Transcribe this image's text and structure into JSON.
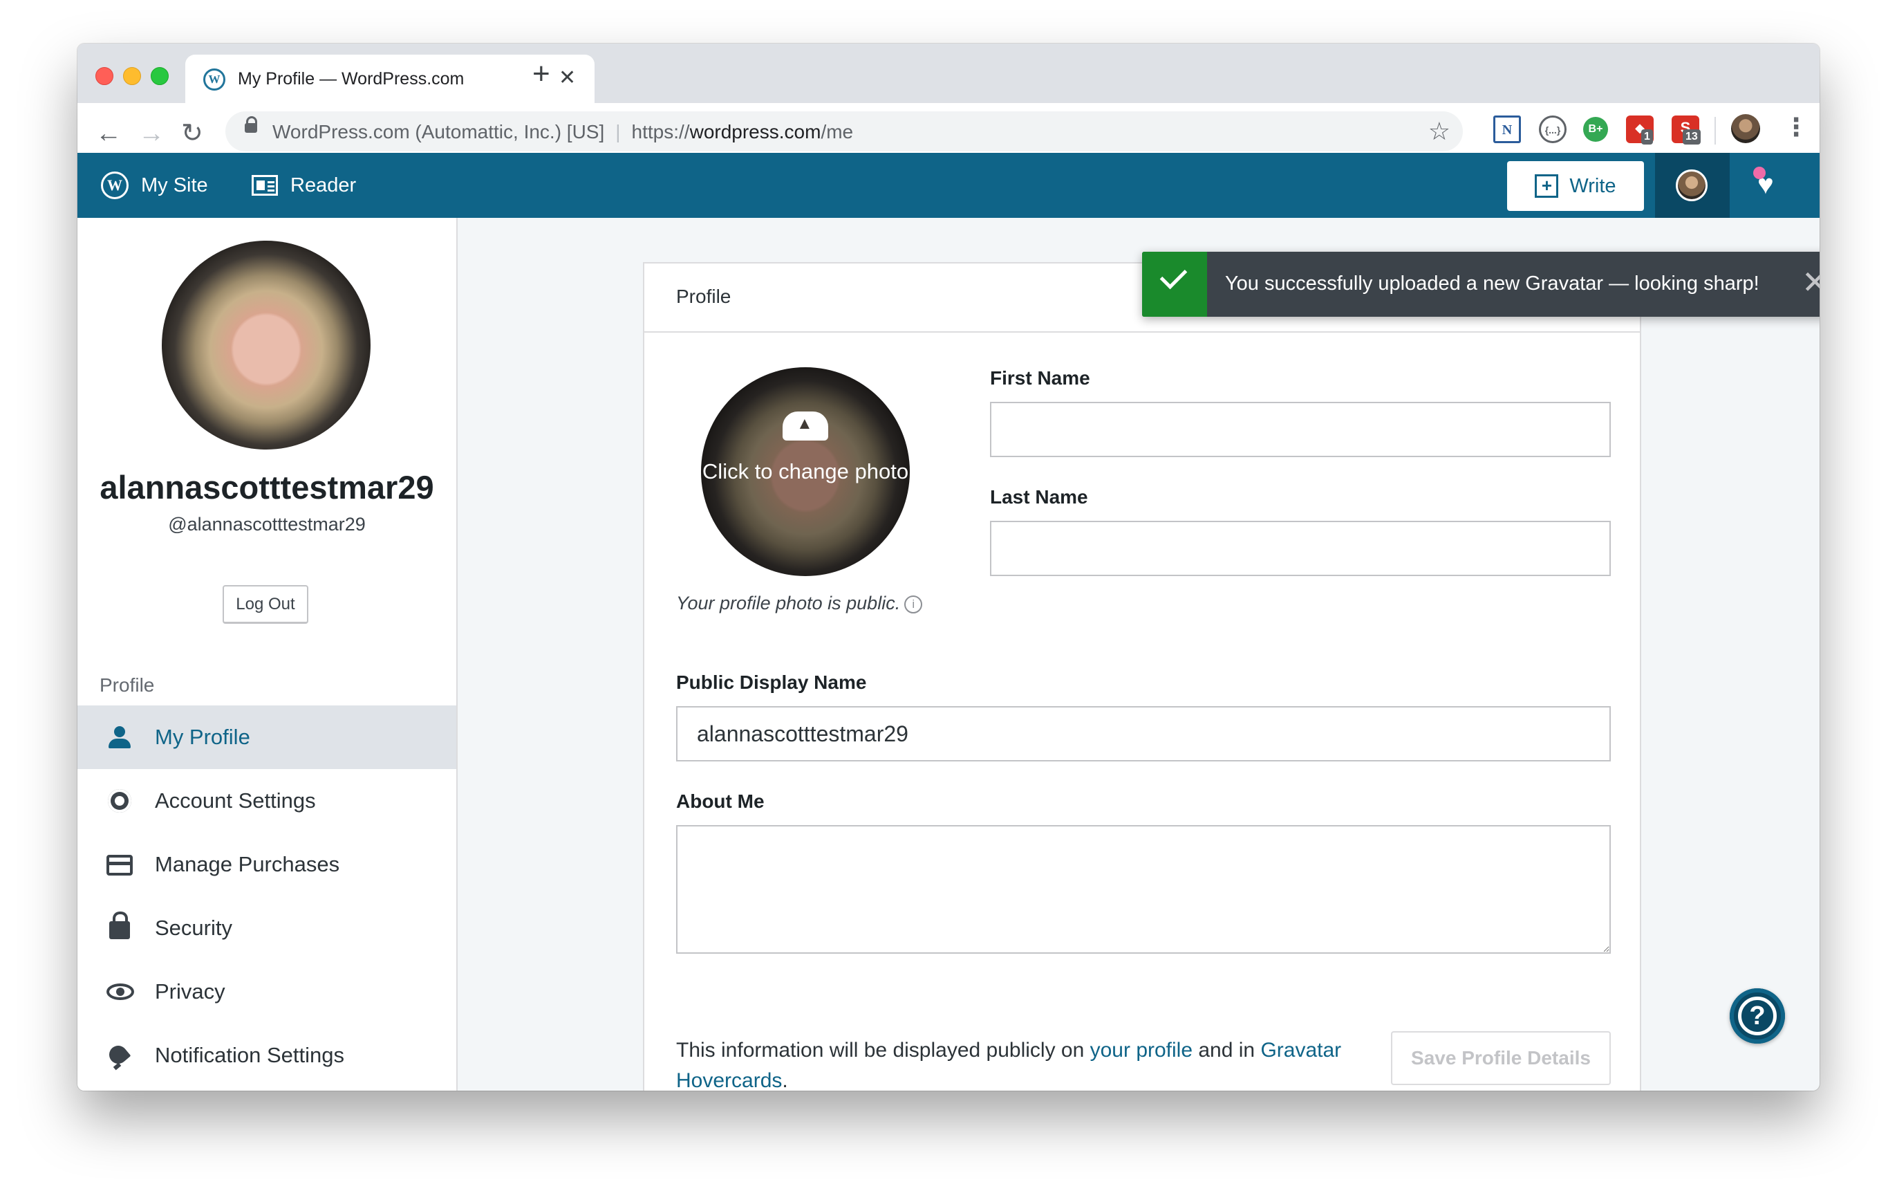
{
  "browser": {
    "tab_title": "My Profile — WordPress.com",
    "tab_close": "✕",
    "new_tab": "+",
    "back": "←",
    "forward": "→",
    "reload": "↻",
    "site_identity": "WordPress.com (Automattic, Inc.) [US]",
    "url_scheme": "https://",
    "url_host": "wordpress.com",
    "url_path": "/me",
    "star": "☆",
    "extensions": {
      "n_label": "N",
      "code_label": "{...}",
      "bplus_label": "B+",
      "shield_label": "◆",
      "shield_badge": "1",
      "s_label": "S",
      "s_badge": "13"
    },
    "menu": "⋮"
  },
  "masterbar": {
    "my_site": "My Site",
    "reader": "Reader",
    "write": "Write",
    "write_icon": "+",
    "notifications_icon": "♥"
  },
  "sidebar": {
    "username": "alannascotttestmar29",
    "handle": "@alannascotttestmar29",
    "logout": "Log Out",
    "section_title": "Profile",
    "items": [
      {
        "label": "My Profile",
        "icon": "person-icon",
        "selected": true
      },
      {
        "label": "Account Settings",
        "icon": "gear-icon"
      },
      {
        "label": "Manage Purchases",
        "icon": "credit-card-icon"
      },
      {
        "label": "Security",
        "icon": "lock-icon"
      },
      {
        "label": "Privacy",
        "icon": "eye-icon"
      },
      {
        "label": "Notification Settings",
        "icon": "bell-icon"
      }
    ]
  },
  "profile": {
    "card_title": "Profile",
    "photo_overlay": "Click to change photo",
    "photo_note": "Your profile photo is public.",
    "info_icon": "i",
    "first_name_label": "First Name",
    "first_name_value": "",
    "last_name_label": "Last Name",
    "last_name_value": "",
    "display_name_label": "Public Display Name",
    "display_name_value": "alannascotttestmar29",
    "about_label": "About Me",
    "about_value": "",
    "footer_prefix": "This information will be displayed publicly on ",
    "footer_link1": "your profile",
    "footer_mid": " and in ",
    "footer_link2": "Gravatar Hovercards",
    "footer_suffix": ".",
    "save_button": "Save Profile Details"
  },
  "notice": {
    "text": "You successfully uploaded a new Gravatar — looking sharp!",
    "close": "✕"
  },
  "help": {
    "label": "?"
  },
  "colors": {
    "masterbar": "#0f6488",
    "masterbar_dark": "#0a4864",
    "link": "#0f6488",
    "notice_bg": "#3c434a",
    "notice_success": "#1a8a2c",
    "selected_bg": "#dfe3e8"
  }
}
